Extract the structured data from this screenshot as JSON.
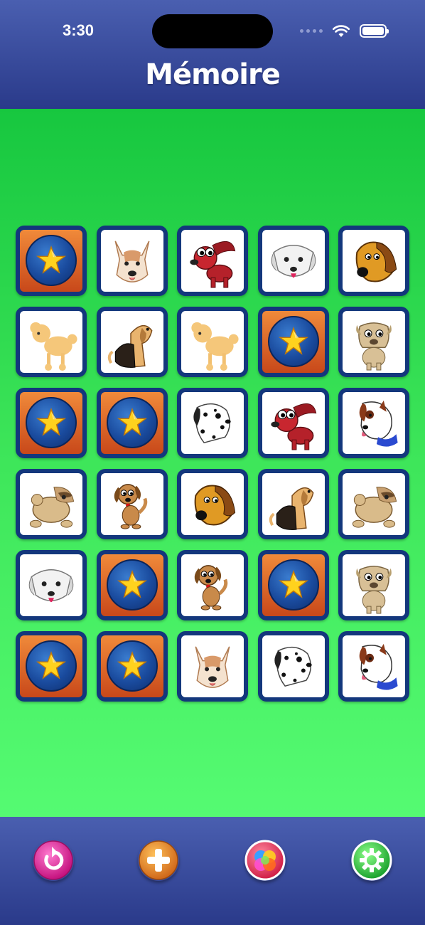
{
  "status": {
    "time": "3:30"
  },
  "header": {
    "title": "Mémoire"
  },
  "cards": [
    "back",
    "pitbull",
    "red-dog",
    "white-dog",
    "brown-dog",
    "poodle",
    "beagle",
    "poodle",
    "back",
    "pug",
    "back",
    "back",
    "dalmatian",
    "red-dog",
    "bull-terrier",
    "shaggy-dog",
    "puppy",
    "brown-dog",
    "beagle",
    "shaggy-dog",
    "white-dog",
    "back",
    "puppy",
    "back",
    "pug",
    "back",
    "back",
    "pitbull",
    "dalmatian",
    "bull-terrier"
  ],
  "toolbar": {
    "buttons": [
      {
        "name": "restart-button",
        "icon": "restart-icon",
        "color": "#e0249c"
      },
      {
        "name": "add-button",
        "icon": "plus-icon",
        "color": "#e88a22"
      },
      {
        "name": "themes-button",
        "icon": "color-balls-icon",
        "color": "#e8284a"
      },
      {
        "name": "settings-button",
        "icon": "gear-icon",
        "color": "#2ecc40"
      }
    ]
  }
}
